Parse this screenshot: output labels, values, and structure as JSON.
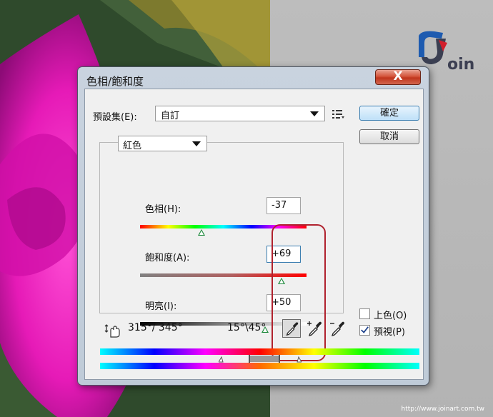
{
  "dialog": {
    "title": "色相/飽和度",
    "close_label": "X",
    "preset_label": "預設集(E):",
    "preset_value": "自訂",
    "ok_label": "確定",
    "cancel_label": "取消"
  },
  "channel": {
    "value": "紅色"
  },
  "sliders": {
    "hue": {
      "label": "色相(H):",
      "value": "-37",
      "thumb_fraction": 0.37
    },
    "saturation": {
      "label": "飽和度(A):",
      "value": "+69",
      "thumb_fraction": 0.85
    },
    "lightness": {
      "label": "明亮(I):",
      "value": "+50",
      "thumb_fraction": 0.75
    }
  },
  "ranges": {
    "outer": "315°/ 345°",
    "inner": "15°\\45°"
  },
  "options": {
    "colorize_label": "上色(O)",
    "colorize_checked": false,
    "preview_label": "預視(P)",
    "preview_checked": true
  },
  "branding": {
    "logo_text": "oin",
    "watermark": "http://www.joinart.com.tw"
  },
  "colors": {
    "highlight": "#b0222e",
    "accent": "#3c7fb1",
    "close": "#c0351d"
  }
}
